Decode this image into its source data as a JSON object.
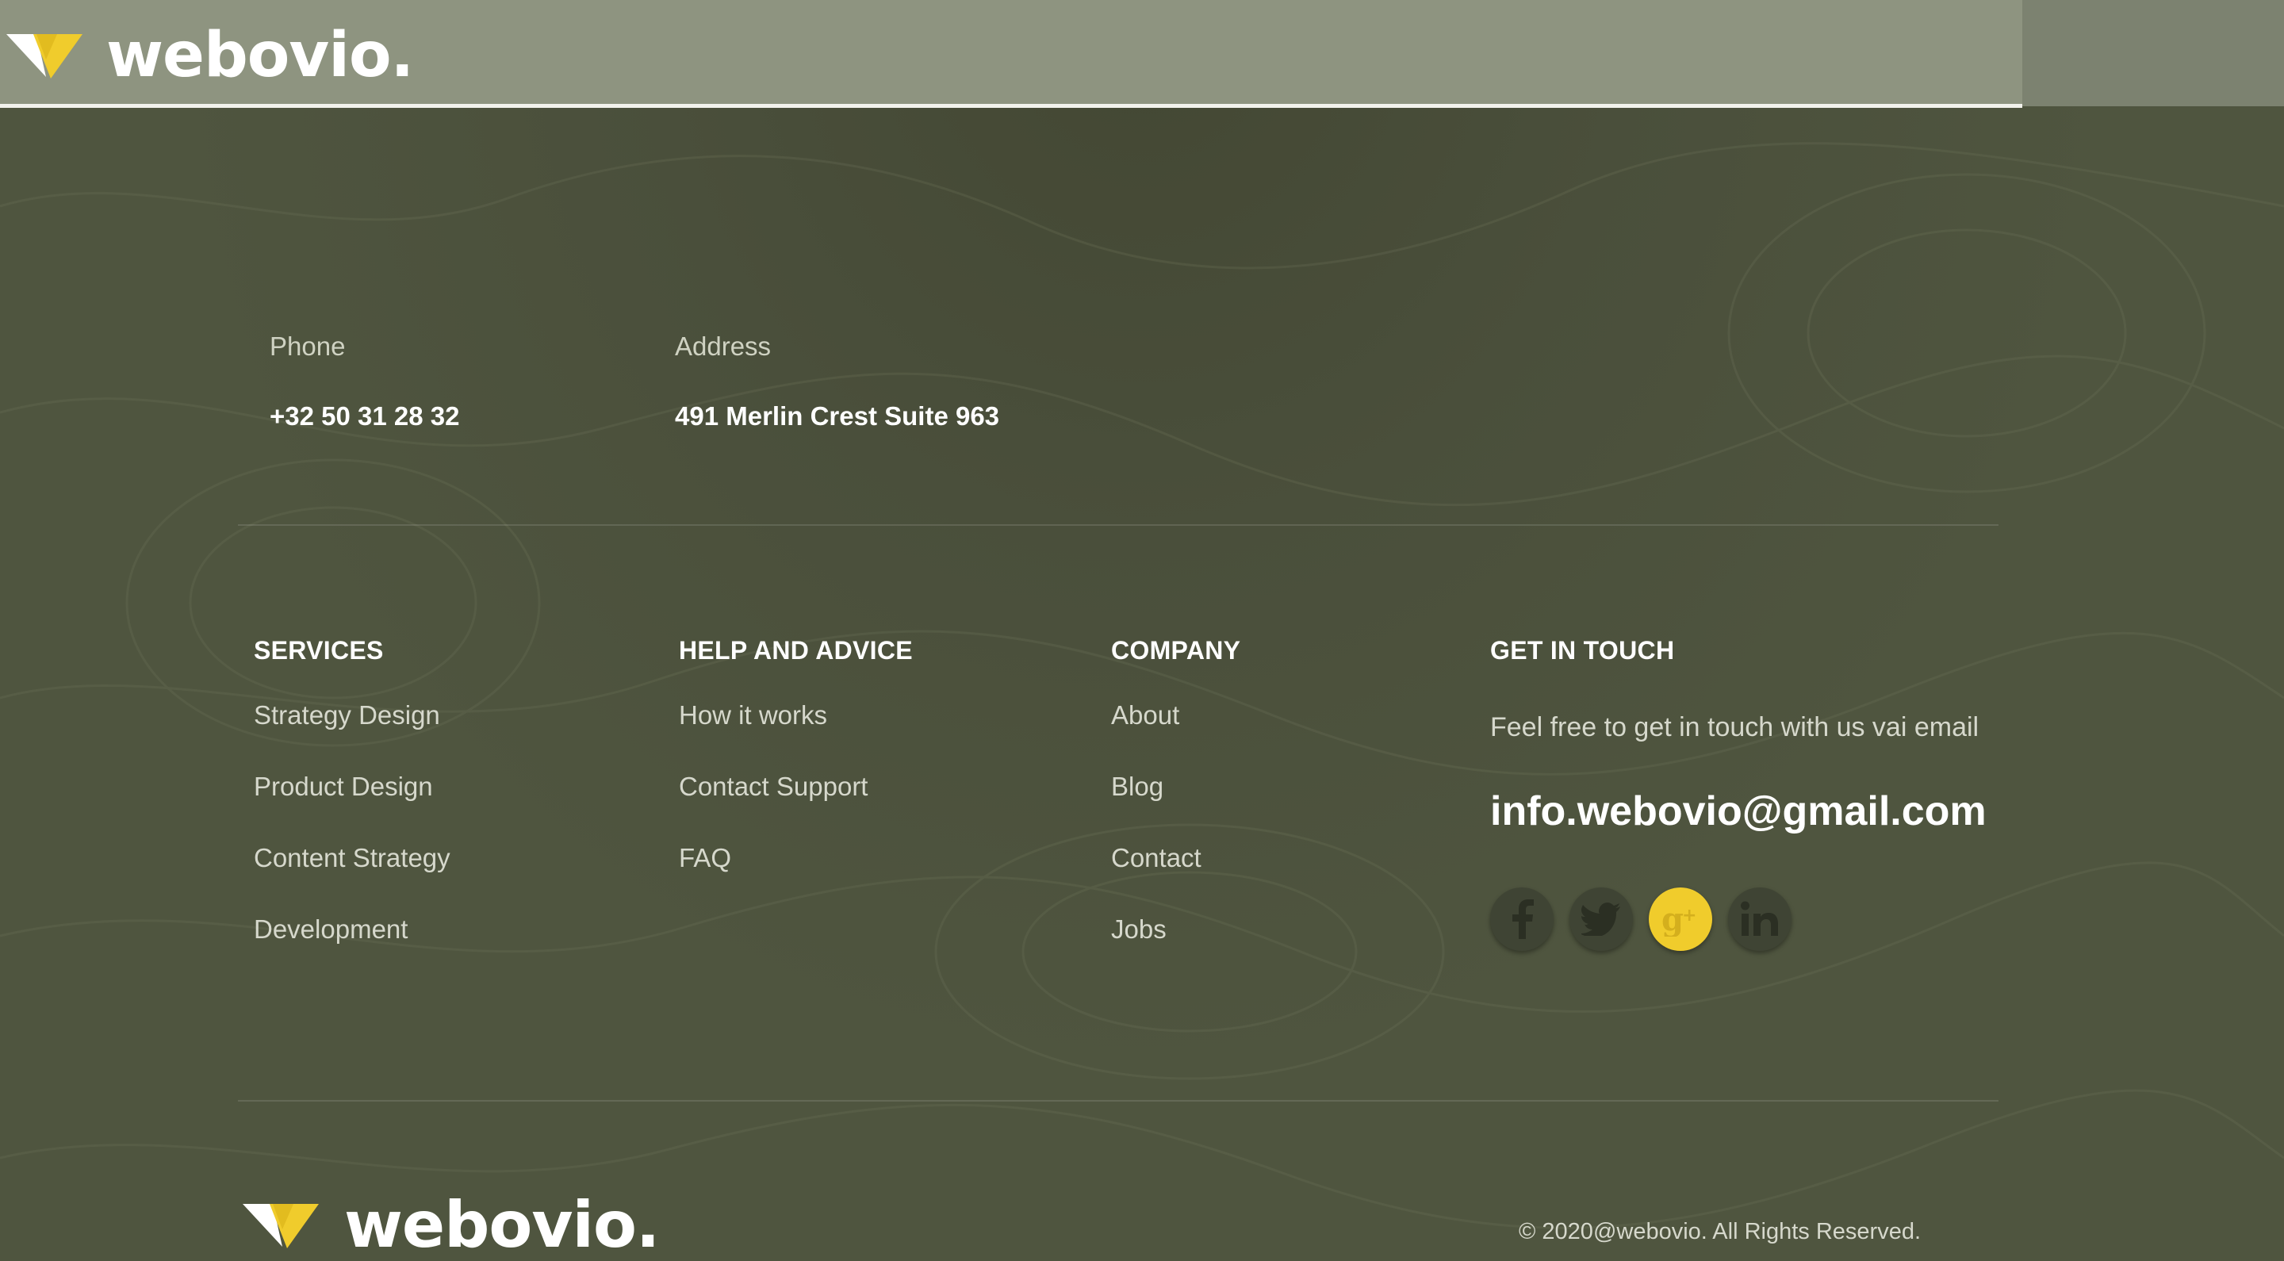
{
  "brand": {
    "name": "webovio.",
    "colors": {
      "yellow": "#f0cc2c",
      "white": "#ffffff",
      "header_bg": "#8e9480",
      "footer_bg": "#4f553f"
    }
  },
  "header": {
    "menu_icon": "hamburger-icon"
  },
  "contact": {
    "phone": {
      "label": "Phone",
      "value": "+32 50 31 28 32"
    },
    "address": {
      "label": "Address",
      "value": "491 Merlin Crest Suite 963"
    }
  },
  "columns": {
    "services": {
      "title": "SERVICES",
      "items": [
        "Strategy Design",
        "Product Design",
        "Content Strategy",
        "Development"
      ]
    },
    "help": {
      "title": "HELP AND ADVICE",
      "items": [
        "How it works",
        "Contact Support",
        "FAQ"
      ]
    },
    "company": {
      "title": "COMPANY",
      "items": [
        "About",
        "Blog",
        "Contact",
        "Jobs"
      ]
    },
    "touch": {
      "title": "GET IN TOUCH",
      "text": "Feel free to get in touch with us vai email",
      "email": "info.webovio@gmail.com"
    }
  },
  "socials": [
    {
      "name": "facebook-icon",
      "glyph": "f",
      "active": false
    },
    {
      "name": "twitter-icon",
      "glyph": "t",
      "active": false
    },
    {
      "name": "google-plus-icon",
      "glyph": "g+",
      "active": true
    },
    {
      "name": "linkedin-icon",
      "glyph": "in",
      "active": false
    }
  ],
  "footer": {
    "copyright": "© 2020@webovio. All Rights Reserved."
  }
}
